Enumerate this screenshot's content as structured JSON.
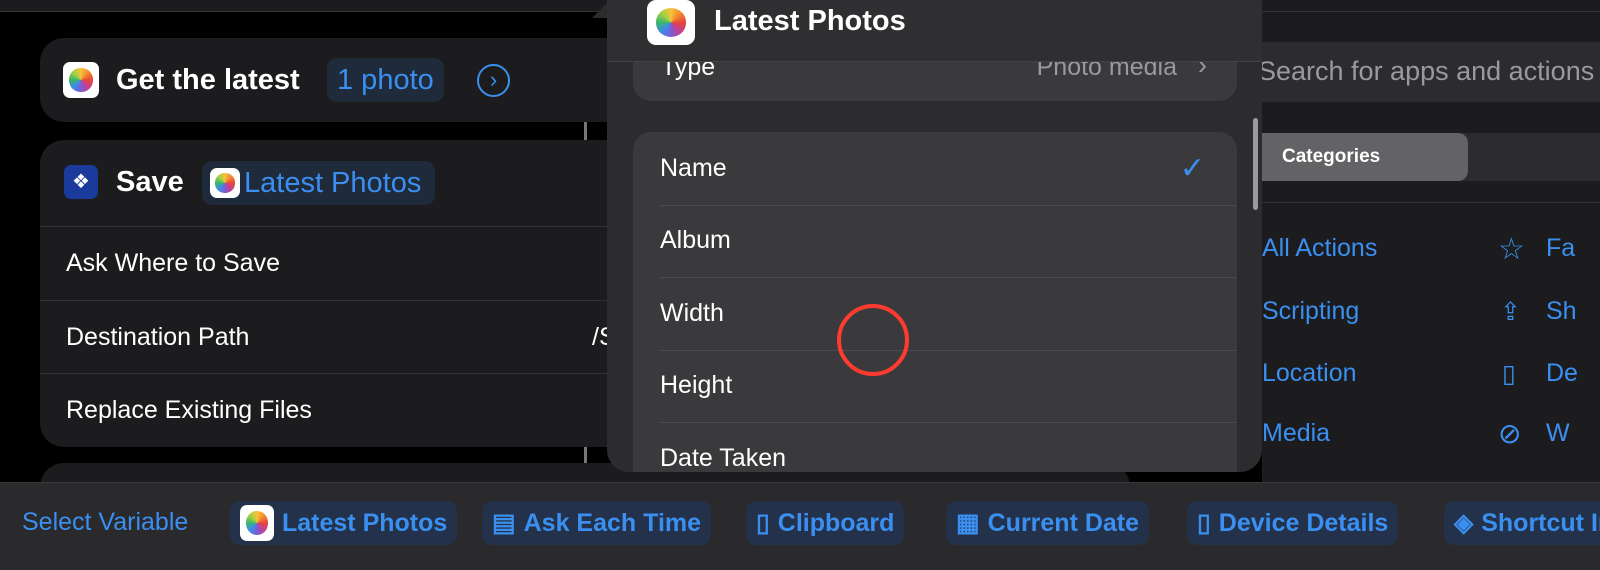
{
  "editor": {
    "get_latest": {
      "label": "Get the latest",
      "param": "1 photo"
    },
    "save": {
      "label": "Save",
      "variable": "Latest Photos"
    },
    "rows": [
      {
        "label": "Ask Where to Save"
      },
      {
        "label": "Destination Path",
        "value": "/S"
      },
      {
        "label": "Replace Existing Files"
      }
    ]
  },
  "popover": {
    "title": "Latest Photos",
    "type_label": "Type",
    "type_value": "Photo media",
    "options": [
      {
        "label": "Name",
        "selected": true
      },
      {
        "label": "Album",
        "selected": false
      },
      {
        "label": "Width",
        "selected": false
      },
      {
        "label": "Height",
        "selected": false
      },
      {
        "label": "Date Taken",
        "selected": false
      }
    ]
  },
  "library": {
    "search_placeholder": "Search for apps and actions",
    "segment": "Categories",
    "left_items": [
      "All Actions",
      "Scripting",
      "Location",
      "Media"
    ],
    "right_items": [
      {
        "icon": "star-icon",
        "label": "Fa"
      },
      {
        "icon": "share-icon",
        "label": "Sh"
      },
      {
        "icon": "document-icon",
        "label": "De"
      },
      {
        "icon": "compass-icon",
        "label": "W"
      }
    ]
  },
  "variable_bar": {
    "label": "Select Variable",
    "chips": [
      "Latest Photos",
      "Ask Each Time",
      "Clipboard",
      "Current Date",
      "Device Details",
      "Shortcut Input"
    ]
  },
  "colors": {
    "accent": "#3a8ff0",
    "cursor": "#ff3b30"
  }
}
